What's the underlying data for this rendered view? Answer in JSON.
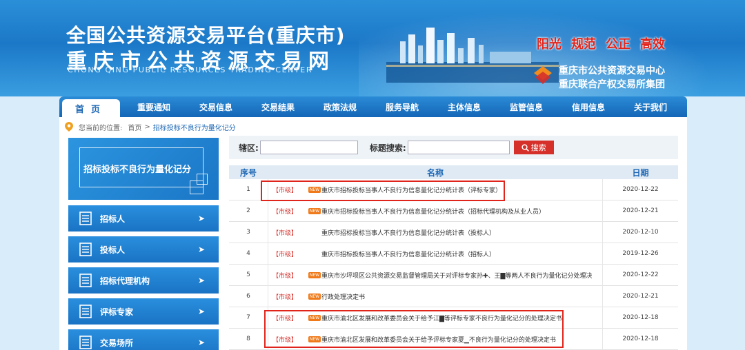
{
  "header": {
    "title_cn": "全国公共资源交易平台(重庆市)",
    "subtitle_cn": "重庆市公共资源交易网",
    "subtitle_en": "CHONG QING PUBLIC RESOURCES TRADING CENTER",
    "slogans": [
      "阳光",
      "规范",
      "公正",
      "高效"
    ],
    "org_1": "重庆市公共资源交易中心",
    "org_2": "重庆联合产权交易所集团"
  },
  "nav": {
    "items": [
      "首页",
      "重要通知",
      "交易信息",
      "交易结果",
      "政策法规",
      "服务导航",
      "主体信息",
      "监管信息",
      "信用信息",
      "关于我们"
    ]
  },
  "breadcrumb": {
    "prefix": "您当前的位置:",
    "home": "首页",
    "sep": ">",
    "current": "招标投标不良行为量化记分"
  },
  "sidebar": {
    "banner": "招标投标不良行为量化记分",
    "items": [
      "招标人",
      "投标人",
      "招标代理机构",
      "评标专家",
      "交易场所"
    ],
    "arrow": "➤"
  },
  "search": {
    "district_label": "辖区:",
    "district_value": "",
    "title_label": "标题搜索:",
    "title_value": "",
    "button": "搜索"
  },
  "table": {
    "headers": {
      "no": "序号",
      "name": "名称",
      "date": "日期"
    },
    "new_badge": "NEW",
    "rows": [
      {
        "no": "1",
        "level": "【市级】",
        "new": true,
        "title": "重庆市招标投标当事人不良行为信息量化记分统计表（评标专家）",
        "date": "2020-12-22"
      },
      {
        "no": "2",
        "level": "【市级】",
        "new": true,
        "title": "重庆市招标投标当事人不良行为信息量化记分统计表（招标代理机构及从业人员）",
        "date": "2020-12-21"
      },
      {
        "no": "3",
        "level": "【市级】",
        "new": false,
        "title": "重庆市招标投标当事人不良行为信息量化记分统计表（投标人）",
        "date": "2020-12-10"
      },
      {
        "no": "4",
        "level": "【市级】",
        "new": false,
        "title": "重庆市招标投标当事人不良行为信息量化记分统计表（招标人）",
        "date": "2019-12-26"
      },
      {
        "no": "5",
        "level": "【市级】",
        "new": true,
        "title": "重庆市沙坪坝区公共资源交易监督管理局关于对评标专家孙✚、王▇等两人不良行为量化记分处理决",
        "date": "2020-12-22"
      },
      {
        "no": "6",
        "level": "【市级】",
        "new": true,
        "title": "行政处理决定书",
        "date": "2020-12-21"
      },
      {
        "no": "7",
        "level": "【市级】",
        "new": true,
        "title": "重庆市渝北区发展和改革委员会关于给予江▇等评标专家不良行为量化记分的处理决定书",
        "date": "2020-12-18"
      },
      {
        "no": "8",
        "level": "【市级】",
        "new": true,
        "title": "重庆市渝北区发展和改革委员会关于给予评标专家夏▁不良行为量化记分的处理决定书",
        "date": "2020-12-18"
      }
    ]
  },
  "colors": {
    "accent": "#1b66b4",
    "highlight": "#e0241b",
    "level_red": "#d6302a",
    "new_orange": "#f07a1a"
  }
}
